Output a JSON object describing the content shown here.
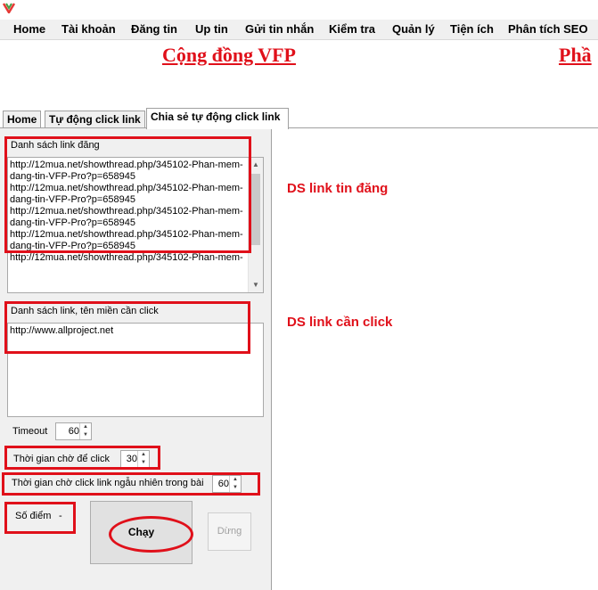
{
  "menubar": {
    "items": [
      "Home",
      "Tài khoản",
      "Đăng tin",
      "Up tin",
      "Gửi tin nhắn",
      "Kiểm tra",
      "Quản lý",
      "Tiện ích",
      "Phân tích SEO"
    ]
  },
  "banner": {
    "title": "Cộng đồng VFP",
    "title_right": "Phầ"
  },
  "tabs": [
    {
      "label": "Home"
    },
    {
      "label": "Tự động click link"
    },
    {
      "label": "Chia sẻ tự động click link",
      "active": true
    }
  ],
  "form": {
    "post_links": {
      "label": "Danh sách link đăng",
      "value": "http://12mua.net/showthread.php/345102-Phan-mem-dang-tin-VFP-Pro?p=658945\nhttp://12mua.net/showthread.php/345102-Phan-mem-dang-tin-VFP-Pro?p=658945\nhttp://12mua.net/showthread.php/345102-Phan-mem-dang-tin-VFP-Pro?p=658945\nhttp://12mua.net/showthread.php/345102-Phan-mem-dang-tin-VFP-Pro?p=658945\nhttp://12mua.net/showthread.php/345102-Phan-mem-"
    },
    "click_links": {
      "label": "Danh sách link, tên miền cần click",
      "value": "http://www.allproject.net"
    },
    "timeout": {
      "label": "Timeout",
      "value": "60"
    },
    "wait_click": {
      "label": "Thời gian chờ để click",
      "value": "30"
    },
    "wait_random": {
      "label": "Thời gian chờ click link ngẫu nhiên trong bài",
      "value": "60"
    },
    "points": {
      "label": "Số điểm",
      "value": "-"
    },
    "run_button": "Chạy",
    "stop_button": "Dừng"
  },
  "annotations": {
    "post_links_note": "DS link tin đăng",
    "click_links_note": "DS link cần click"
  },
  "colors": {
    "annotation_red": "#e0101a",
    "panel_gray": "#f0f0f0"
  }
}
